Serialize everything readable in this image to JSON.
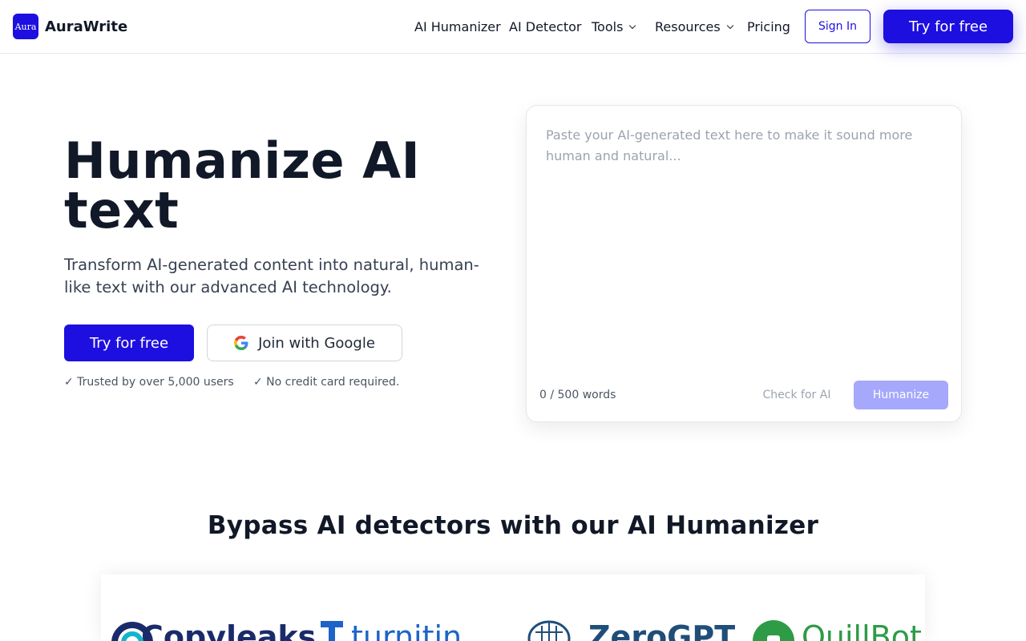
{
  "header": {
    "logo_mark": "Aura",
    "brand": "AuraWrite",
    "nav": [
      {
        "label": "AI Humanizer",
        "dropdown": false
      },
      {
        "label": "AI Detector",
        "dropdown": false
      },
      {
        "label": "Tools",
        "dropdown": true
      },
      {
        "label": "Resources",
        "dropdown": true
      },
      {
        "label": "Pricing",
        "dropdown": false
      }
    ],
    "sign_in": "Sign In",
    "try_free": "Try for free"
  },
  "hero": {
    "title": "Humanize AI text",
    "subtitle": "Transform AI-generated content into natural, human-like text with our advanced AI technology.",
    "try_free": "Try for free",
    "google": "Join with Google",
    "trust_1": "✓ Trusted by over 5,000 users",
    "trust_2": "✓ No credit card required."
  },
  "editor": {
    "placeholder": "Paste your AI-generated text here to make it sound more human and natural...",
    "word_count": "0 / 500 words",
    "check": "Check for AI",
    "humanize": "Humanize"
  },
  "bypass": {
    "title": "Bypass AI detectors with our AI Humanizer",
    "logos": [
      "Copyleaks",
      "turnitin",
      "ZeroGPT",
      "QuillBot"
    ]
  },
  "colors": {
    "primary": "#1d0fe0",
    "humanize_disabled": "#a5a8fb",
    "text_dark": "#111827"
  }
}
